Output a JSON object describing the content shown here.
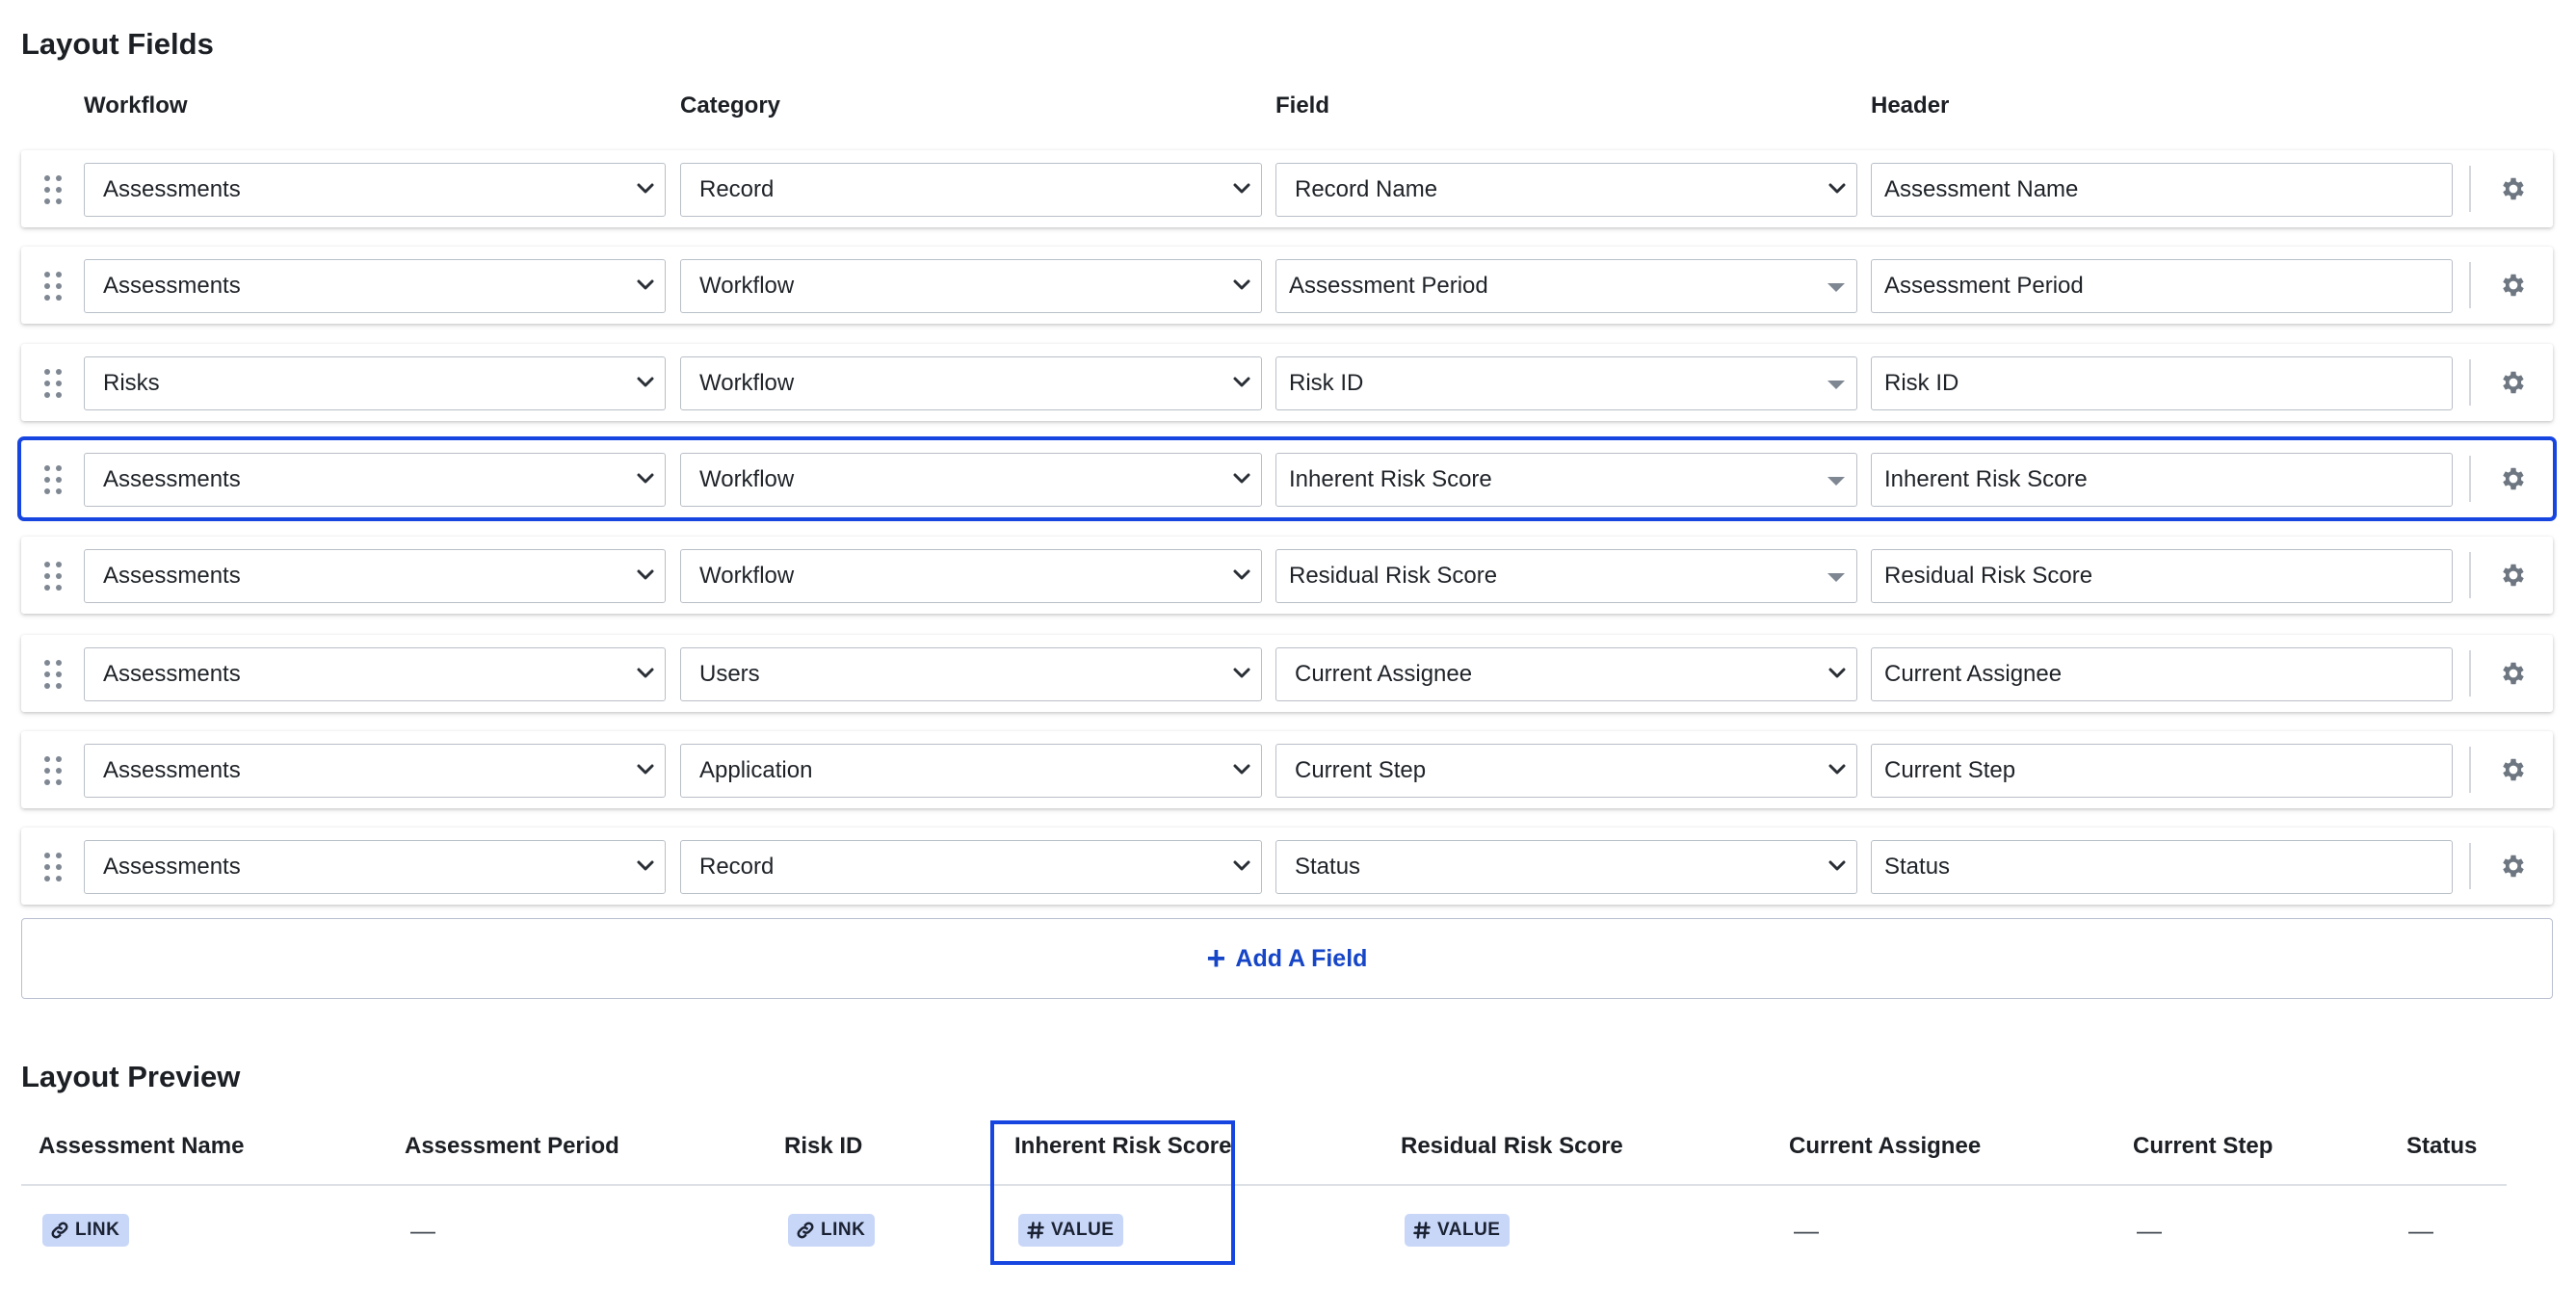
{
  "layout_fields": {
    "title": "Layout Fields",
    "columns": [
      "Workflow",
      "Category",
      "Field",
      "Header"
    ],
    "rows": [
      {
        "workflow": "Assessments",
        "category": "Record",
        "field": "Record Name",
        "header": "Assessment Name",
        "field_style": "select"
      },
      {
        "workflow": "Assessments",
        "category": "Workflow",
        "field": "Assessment Period",
        "header": "Assessment Period",
        "field_style": "dropdown"
      },
      {
        "workflow": "Risks",
        "category": "Workflow",
        "field": "Risk ID",
        "header": "Risk ID",
        "field_style": "dropdown"
      },
      {
        "workflow": "Assessments",
        "category": "Workflow",
        "field": "Inherent Risk Score",
        "header": "Inherent Risk Score",
        "field_style": "dropdown",
        "selected": true
      },
      {
        "workflow": "Assessments",
        "category": "Workflow",
        "field": "Residual Risk Score",
        "header": "Residual Risk Score",
        "field_style": "dropdown"
      },
      {
        "workflow": "Assessments",
        "category": "Users",
        "field": "Current Assignee",
        "header": "Current Assignee",
        "field_style": "select"
      },
      {
        "workflow": "Assessments",
        "category": "Application",
        "field": "Current Step",
        "header": "Current Step",
        "field_style": "select"
      },
      {
        "workflow": "Assessments",
        "category": "Record",
        "field": "Status",
        "header": "Status",
        "field_style": "select"
      }
    ],
    "add_button_label": "Add A Field",
    "icons": {
      "drag": "drag-handle-icon",
      "settings": "gear-icon",
      "add": "plus-icon"
    }
  },
  "layout_preview": {
    "title": "Layout Preview",
    "columns": [
      {
        "header": "Assessment Name",
        "cell_type": "pill",
        "icon": "link-icon",
        "cell": "LINK"
      },
      {
        "header": "Assessment Period",
        "cell_type": "empty",
        "cell": "—"
      },
      {
        "header": "Risk ID",
        "cell_type": "pill",
        "icon": "link-icon",
        "cell": "LINK"
      },
      {
        "header": "Inherent Risk Score",
        "cell_type": "pill",
        "icon": "hash-icon",
        "cell": "VALUE",
        "highlighted": true
      },
      {
        "header": "Residual Risk Score",
        "cell_type": "pill",
        "icon": "hash-icon",
        "cell": "VALUE"
      },
      {
        "header": "Current Assignee",
        "cell_type": "empty",
        "cell": "—"
      },
      {
        "header": "Current Step",
        "cell_type": "empty",
        "cell": "—"
      },
      {
        "header": "Status",
        "cell_type": "empty",
        "cell": "—"
      }
    ]
  },
  "colors": {
    "accent": "#1745e0",
    "link_text": "#1645c7",
    "pill_bg": "#c8d6f8"
  }
}
